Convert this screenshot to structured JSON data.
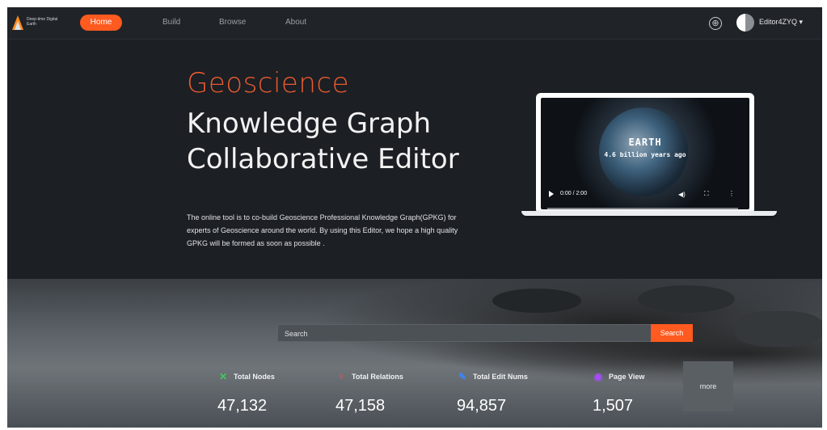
{
  "nav": {
    "logo_text": "Deep-time Digital Earth",
    "items": [
      {
        "label": "Home"
      },
      {
        "label": "Build"
      },
      {
        "label": "Browse"
      },
      {
        "label": "About"
      }
    ],
    "user": "Editor4ZYQ ▾"
  },
  "hero": {
    "title_line1": "Geoscience",
    "title_line2": "Knowledge Graph",
    "title_line3": "Collaborative Editor",
    "description": "The online tool is to co-build Geoscience Professional Knowledge Graph(GPKG) for experts of Geoscience around the world. By using this Editor, we hope a high quality GPKG will be formed as soon as possible ."
  },
  "video": {
    "title": "EARTH",
    "subtitle": "4.6 billion years ago",
    "time": "0:00 / 2:00"
  },
  "search": {
    "placeholder": "Search",
    "button_label": "Search"
  },
  "stats": [
    {
      "label": "Total Nodes",
      "value": "47,132",
      "icon": "nodes-icon",
      "color": "#3ecb5a"
    },
    {
      "label": "Total Relations",
      "value": "47,158",
      "icon": "relations-icon",
      "color": "#ff4b4b"
    },
    {
      "label": "Total Edit Nums",
      "value": "94,857",
      "icon": "edit-icon",
      "color": "#3a86ff"
    },
    {
      "label": "Page View",
      "value": "1,507",
      "icon": "eye-icon",
      "color": "#a84bff"
    }
  ],
  "more_label": "more",
  "colors": {
    "accent": "#ff5a1f",
    "background": "#1c1f24"
  }
}
